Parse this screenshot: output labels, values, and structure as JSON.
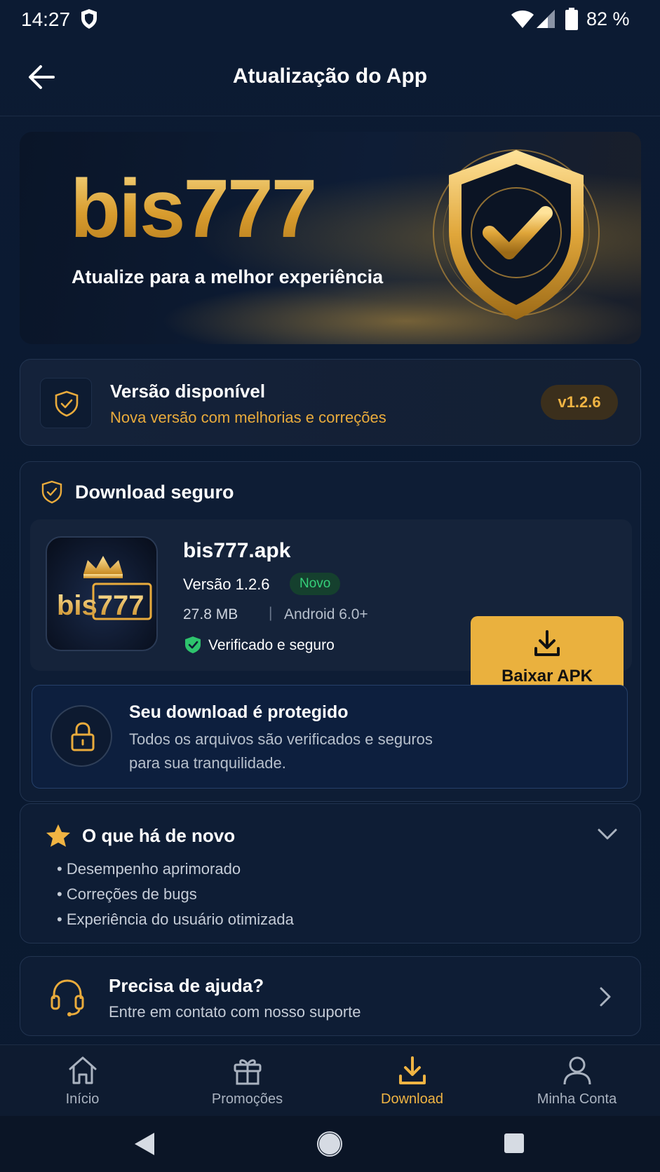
{
  "status_bar": {
    "time": "14:27",
    "battery_percent": "82 %",
    "icons": [
      "shield-icon",
      "wifi-icon",
      "signal-icon",
      "battery-icon"
    ]
  },
  "header": {
    "title": "Atualização do App",
    "back_icon": "arrow-left-icon"
  },
  "hero": {
    "brand": "bis777",
    "tagline": "Atualize para a melhor experiência",
    "icon": "shield-check-icon"
  },
  "version_card": {
    "title": "Versão disponível",
    "subtitle": "Nova versão com melhorias e correções",
    "badge": "v1.2.6"
  },
  "download": {
    "section_title": "Download seguro",
    "app": {
      "icon_text": "bis777",
      "name": "bis777.apk",
      "version": "Versão 1.2.6",
      "badge": "Novo",
      "size": "27.8 MB",
      "separator": "|",
      "android": "Android 6.0+",
      "verified": "Verificado e seguro"
    },
    "button_label": "Baixar APK",
    "protect": {
      "title": "Seu download é protegido",
      "line1": "Todos os arquivos são verificados e seguros",
      "line2": "para sua tranquilidade."
    }
  },
  "whats_new": {
    "title": "O que há de novo",
    "items": [
      "• Desempenho aprimorado",
      "• Correções de bugs",
      "• Experiência do usuário otimizada"
    ]
  },
  "help": {
    "title": "Precisa de ajuda?",
    "subtitle": "Entre em contato com nosso suporte"
  },
  "bottom_nav": {
    "items": [
      {
        "label": "Início",
        "icon": "home-icon"
      },
      {
        "label": "Promoções",
        "icon": "gift-icon"
      },
      {
        "label": "Download",
        "icon": "download-icon",
        "active": true
      },
      {
        "label": "Minha Conta",
        "icon": "user-icon"
      }
    ]
  },
  "colors": {
    "background": "#0b1a31",
    "accent": "#eab13e",
    "success": "#35d17a"
  }
}
